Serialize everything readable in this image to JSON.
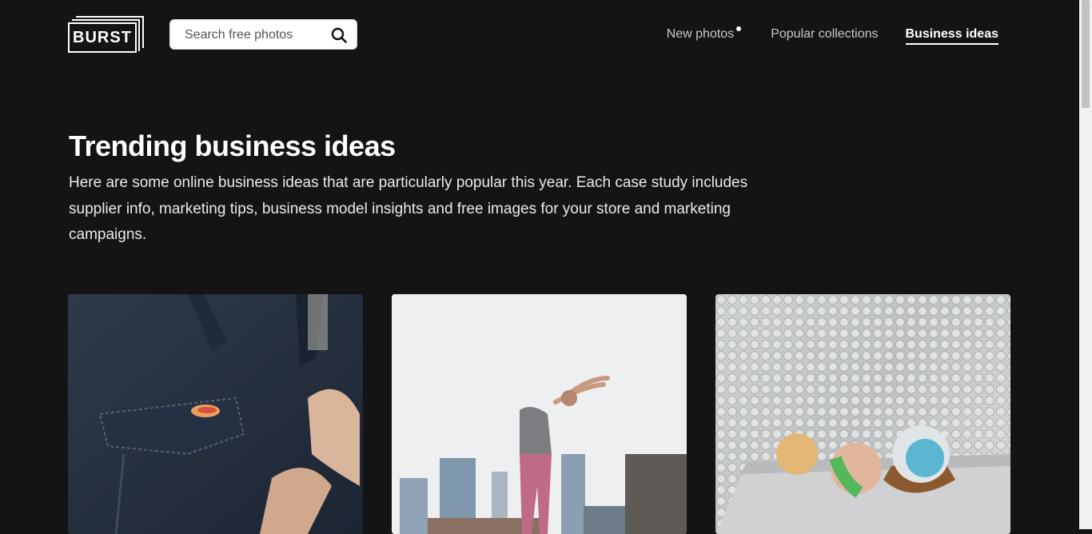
{
  "logo": {
    "text": "BURST"
  },
  "search": {
    "placeholder": "Search free photos"
  },
  "nav": {
    "items": [
      {
        "label": "New photos",
        "has_dot": true
      },
      {
        "label": "Popular collections"
      },
      {
        "label": "Business ideas",
        "active": true
      }
    ]
  },
  "hero": {
    "title": "Trending business ideas",
    "description": "Here are some online business ideas that are particularly popular this year. Each case study includes supplier info, marketing tips, business model insights and free images for your store and marketing campaigns."
  },
  "cards": [
    {
      "image": "denim-jacket-pin-photo"
    },
    {
      "image": "yoga-stretch-city-photo"
    },
    {
      "image": "bath-bombs-shelf-photo"
    }
  ],
  "colors": {
    "background": "#141414",
    "text": "#ffffff",
    "nav_inactive": "#c9c9c9"
  }
}
